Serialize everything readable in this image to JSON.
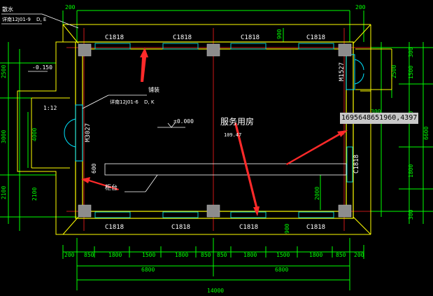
{
  "colors": {
    "background": "#000000",
    "wall": "#ffff00",
    "column": "#8c8c8c",
    "dimension": "#00ff00",
    "window": "#00c8c8",
    "door": "#00e5ff",
    "axis": "#ff2020",
    "annotation_arrow": "#ff2a2a",
    "text": "#ffffff"
  },
  "labels": {
    "overflow_note_top": "散水",
    "detail_ref_top": "详南12J01-9",
    "detail_ref_top_sub": "D, E",
    "elevation_outdoor": "-0.150",
    "slope": "1:12",
    "detail_ref_mid": "详南12J01-6",
    "detail_ref_mid_title": "铺装",
    "detail_ref_mid_sub": "D, K",
    "floor_level": "±0.000",
    "room_name": "服务用房",
    "room_area": "109.47",
    "counter": "柜台",
    "counter_depth": "600",
    "coord_readout": "1695648651960,4397"
  },
  "windows": {
    "top": [
      "C1818",
      "C1818",
      "C1818",
      "C1818"
    ],
    "bottom": [
      "C1818",
      "C1818",
      "C1818",
      "C1818"
    ],
    "right": "C1818"
  },
  "doors": {
    "left": "M3027",
    "right": "M1527"
  },
  "dims_top": [
    "200",
    "200"
  ],
  "dims_top_right": "900",
  "dims_bottom_right": "900",
  "dims_bottom_row1": [
    "200",
    "850",
    "1800",
    "1500",
    "1800",
    "850",
    "850",
    "1800",
    "1500",
    "1800",
    "850",
    "200"
  ],
  "dims_bottom_row2": [
    "6800",
    "6800"
  ],
  "dims_bottom_row3": "14000",
  "dims_left": [
    "2500",
    "3000",
    "2100"
  ],
  "dim_left_inner": "4000",
  "dims_right": [
    "300",
    "1500",
    "1800",
    "1800",
    "300"
  ],
  "dims_right_inner": [
    "2500",
    "300",
    "2000"
  ],
  "dim_right_total": "6600"
}
